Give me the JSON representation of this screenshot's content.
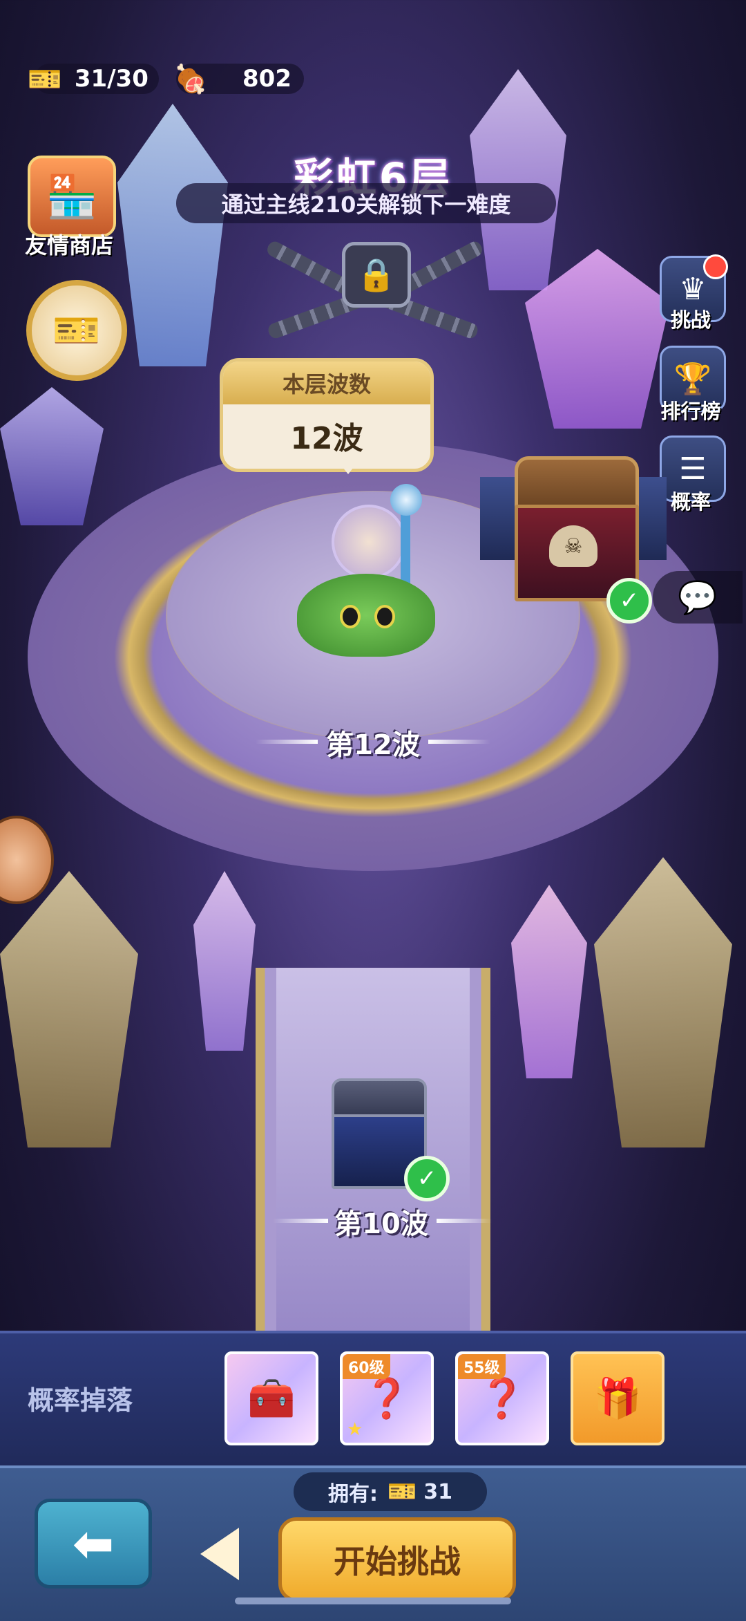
{
  "resources": {
    "tickets": "31/30",
    "food": "802"
  },
  "title": "彩虹6层",
  "subtitle": "通过主线210关解锁下一难度",
  "left_menu": {
    "shop_label": "友情商店"
  },
  "right_menu": {
    "challenge_label": "挑战",
    "ranking_label": "排行榜",
    "probability_label": "概率"
  },
  "wave_bubble": {
    "header": "本层波数",
    "value": "12波"
  },
  "waves": {
    "current": "第12波",
    "previous": "第10波"
  },
  "drops": {
    "label": "概率掉落",
    "items": [
      {
        "tag": "",
        "icon": "chest-icon"
      },
      {
        "tag": "60级",
        "icon": "armor-icon"
      },
      {
        "tag": "55级",
        "icon": "armor-icon"
      },
      {
        "tag": "",
        "icon": "mystery-chest-icon"
      }
    ]
  },
  "bottom": {
    "own_label": "拥有:",
    "own_count": "31",
    "start_label": "开始挑战"
  },
  "colors": {
    "accent_gold": "#f0ab2c",
    "check_green": "#2fbf4a",
    "panel_blue": "#2d3a79"
  }
}
